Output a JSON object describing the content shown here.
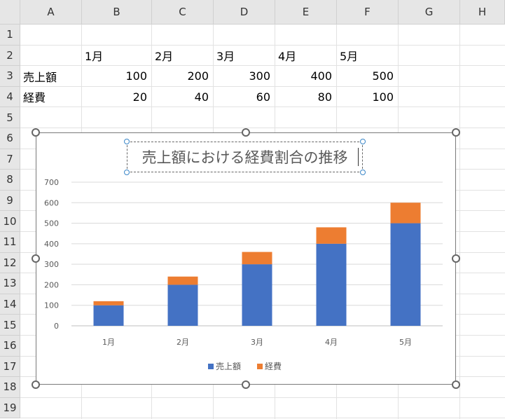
{
  "columns": [
    "A",
    "B",
    "C",
    "D",
    "E",
    "F",
    "G",
    "H"
  ],
  "rows": [
    "1",
    "2",
    "3",
    "4",
    "5",
    "6",
    "7",
    "8",
    "9",
    "10",
    "11",
    "12",
    "13",
    "14",
    "15",
    "16",
    "17",
    "18",
    "19"
  ],
  "cells": {
    "B2": "1月",
    "C2": "2月",
    "D2": "3月",
    "E2": "4月",
    "F2": "5月",
    "A3": "売上額",
    "B3": "100",
    "C3": "200",
    "D3": "300",
    "E3": "400",
    "F3": "500",
    "A4": "経費",
    "B4": "20",
    "C4": "40",
    "D4": "60",
    "E4": "80",
    "F4": "100"
  },
  "chart_data": {
    "type": "bar",
    "stacked": true,
    "title": "売上額における経費割合の推移",
    "categories": [
      "1月",
      "2月",
      "3月",
      "4月",
      "5月"
    ],
    "series": [
      {
        "name": "売上額",
        "values": [
          100,
          200,
          300,
          400,
          500
        ],
        "color": "#4472C4"
      },
      {
        "name": "経費",
        "values": [
          20,
          40,
          60,
          80,
          100
        ],
        "color": "#ED7D31"
      }
    ],
    "ylim": [
      0,
      700
    ],
    "yticks": [
      0,
      100,
      200,
      300,
      400,
      500,
      600,
      700
    ],
    "grid": true,
    "legend": "bottom"
  }
}
